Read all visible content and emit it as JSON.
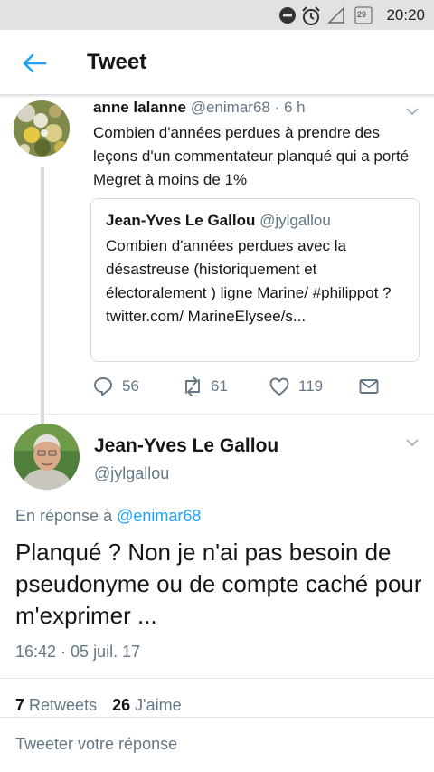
{
  "status_bar": {
    "icons": [
      "do-not-disturb-icon",
      "alarm-icon",
      "signal-icon",
      "calendar-icon"
    ],
    "calendar_day": "29",
    "time": "20:20"
  },
  "header": {
    "title": "Tweet"
  },
  "parent_tweet": {
    "name": "anne lalanne",
    "handle": "@enimar68",
    "time": "· 6 h",
    "text": "Combien d'années perdues à prendre des leçons d'un commentateur planqué qui a porté Megret à moins de 1%",
    "quote": {
      "name": "Jean-Yves Le Gallou",
      "handle": "@jylgallou",
      "text": "Combien d'années perdues avec la désastreuse (historiquement et électoralement ) ligne Marine/ #philippot ? twitter.com/ MarineElysee/s..."
    },
    "actions": {
      "replies": "56",
      "retweets": "61",
      "likes": "119"
    }
  },
  "main_tweet": {
    "name": "Jean-Yves Le Gallou",
    "handle": "@jylgallou",
    "reply_prefix": "En réponse à",
    "reply_mention": "@enimar68",
    "text": "Planqué ? Non je n'ai pas besoin de pseudonyme ou de compte caché pour m'exprimer ...",
    "timestamp": "16:42 · 05 juil. 17",
    "retweets_count": "7",
    "retweets_label": "Retweets",
    "likes_count": "26",
    "likes_label": "J'aime"
  },
  "reply_box": {
    "placeholder": "Tweeter votre réponse"
  },
  "colors": {
    "accent": "#1da1f2",
    "secondary_text": "#657786",
    "status_bar": "#e1e2e3"
  }
}
